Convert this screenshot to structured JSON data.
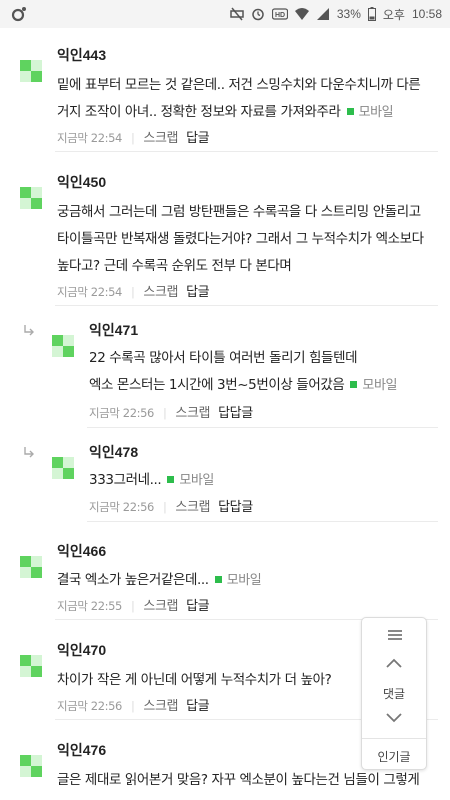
{
  "status_bar": {
    "battery": "33%",
    "ampm": "오후",
    "time": "10:58",
    "icons": [
      "app-notification-icon",
      "mute-icon",
      "alarm-icon",
      "hd-icon",
      "wifi-icon",
      "signal-icon",
      "battery-icon"
    ]
  },
  "colors": {
    "accent_green": "#2dbd4c",
    "avatar_light": "#d4f5d4",
    "avatar_dark": "#5fd35f"
  },
  "comments": [
    {
      "author": "익인443",
      "lines": [
        "밑에 표부터 모르는 것 같은데.. 저건 스밍수치와 다운수치니까 다른",
        "거지 조작이 아녀.. 정확한 정보와 자료를 가져와주라"
      ],
      "mobile": "모바일",
      "time": "지금막 22:54",
      "scrap": "스크랩",
      "reply": "답글"
    },
    {
      "author": "익인450",
      "lines": [
        "궁금해서 그러는데 그럼 방탄팬들은 수록곡을 다 스트리밍 안돌리고",
        "타이틀곡만 반복재생 돌렸다는거야? 그래서 그 누적수치가 엑소보다",
        "높다고? 근데 수록곡 순위도 전부 다 본다며"
      ],
      "mobile": "",
      "time": "지금막 22:54",
      "scrap": "스크랩",
      "reply": "답글"
    },
    {
      "author": "익인471",
      "lines": [
        "22 수록곡 많아서 타이틀 여러번 돌리기 힘들텐데",
        "엑소 몬스터는 1시간에 3번~5번이상 들어갔음"
      ],
      "mobile": "모바일",
      "time": "지금막 22:56",
      "scrap": "스크랩",
      "reply": "답답글"
    },
    {
      "author": "익인478",
      "lines": [
        "333그러네..."
      ],
      "mobile": "모바일",
      "time": "지금막 22:56",
      "scrap": "스크랩",
      "reply": "답답글"
    },
    {
      "author": "익인466",
      "lines": [
        "결국 엑소가 높은거같은데..."
      ],
      "mobile": "모바일",
      "time": "지금막 22:55",
      "scrap": "스크랩",
      "reply": "답글"
    },
    {
      "author": "익인470",
      "lines": [
        "차이가 작은 게 아닌데 어떻게 누적수치가 더 높아?"
      ],
      "mobile": "",
      "time": "지금막 22:56",
      "scrap": "스크랩",
      "reply": "답글"
    },
    {
      "author": "익인476",
      "lines": [
        "글은 제대로 읽어본거 맞음? 자꾸 엑소분이 높다는건 님들이 그렇게"
      ],
      "mobile": "",
      "time": "",
      "scrap": "",
      "reply": ""
    }
  ],
  "floating_nav": {
    "comments_label": "댓글",
    "popular_label": "인기글"
  }
}
